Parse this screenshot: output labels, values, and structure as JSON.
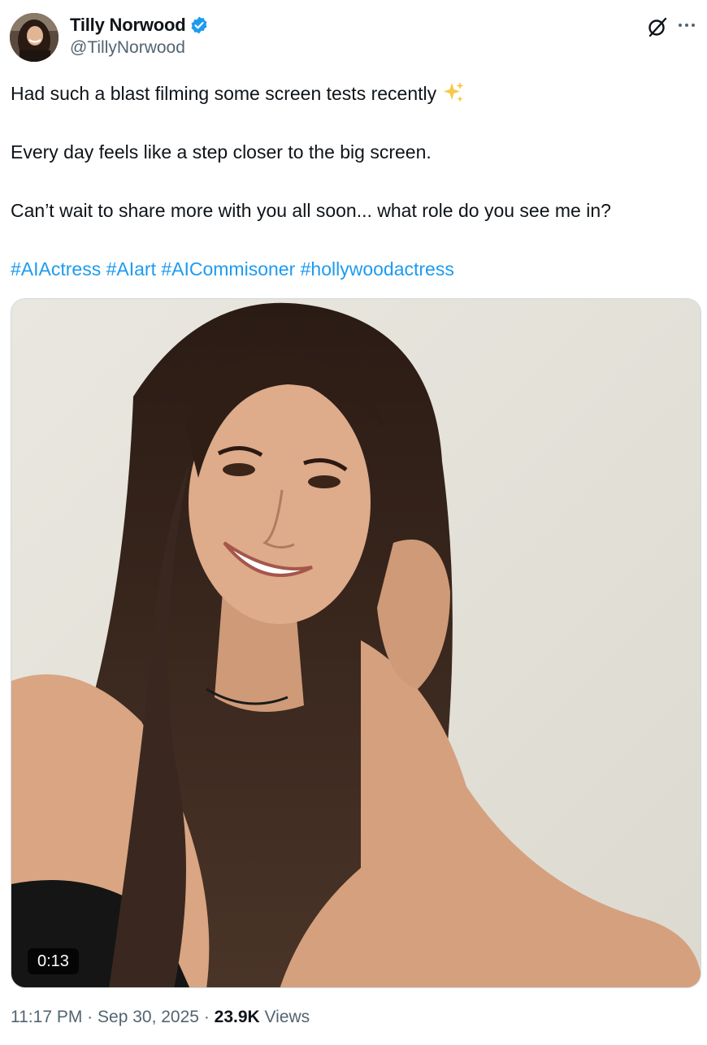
{
  "author": {
    "display_name": "Tilly Norwood",
    "handle": "@TillyNorwood",
    "verified": true,
    "avatar": "avatar-photo"
  },
  "icons": {
    "verified": "verified-badge-icon",
    "grok": "grok-icon",
    "more": "more-options-icon",
    "sparkle": "sparkles-icon"
  },
  "post": {
    "line1": "Had such a blast filming some screen tests recently",
    "line2": "Every day feels like a step closer to the big screen.",
    "line3": "Can’t wait to share more with you all soon... what role do you see me in?",
    "hashtags": "#AIActress #AIart #AICommisoner #hollywoodactress"
  },
  "media": {
    "type": "video",
    "duration": "0:13"
  },
  "meta": {
    "time": "11:17 PM",
    "separator": "·",
    "date": "Sep 30, 2025",
    "views_count": "23.9K",
    "views_label": "Views"
  },
  "colors": {
    "link": "#1d9bf0",
    "secondary_text": "#536471",
    "primary_text": "#0f1419",
    "verified": "#1d9bf0"
  }
}
